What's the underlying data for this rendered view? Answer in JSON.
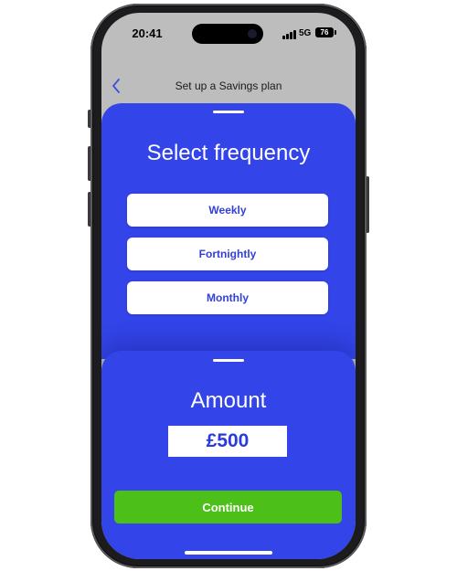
{
  "status_bar": {
    "time": "20:41",
    "network": "5G",
    "battery": "76",
    "icons": [
      "signal-icon",
      "battery-icon"
    ]
  },
  "nav": {
    "title": "Set up a Savings plan",
    "back_icon": "chevron-left-icon"
  },
  "frequency_sheet": {
    "title": "Select frequency",
    "options": [
      {
        "label": "Weekly"
      },
      {
        "label": "Fortnightly"
      },
      {
        "label": "Monthly"
      }
    ]
  },
  "amount_sheet": {
    "title": "Amount",
    "value": "£500",
    "continue_label": "Continue"
  },
  "colors": {
    "sheet_blue": "#3344e8",
    "option_text": "#3340d8",
    "continue_green": "#4cbf18",
    "backdrop_gray": "#bdbdbd",
    "back_chevron": "#3b4fe0"
  }
}
